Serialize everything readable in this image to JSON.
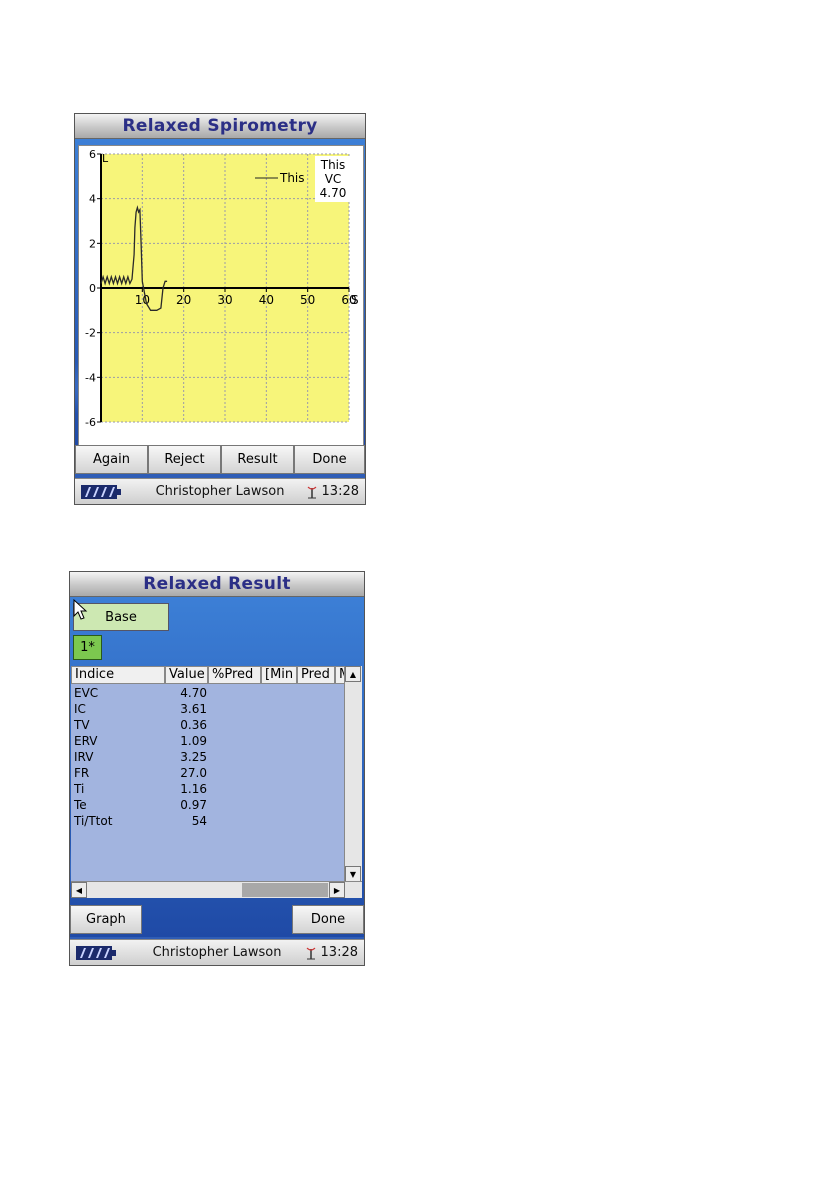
{
  "screen1": {
    "title": "Relaxed Spirometry",
    "legend_line_label": "This",
    "info_box": {
      "line1": "This",
      "line2": "VC",
      "line3": "4.70"
    },
    "buttons": [
      "Again",
      "Reject",
      "Result",
      "Done"
    ],
    "status": {
      "user": "Christopher Lawson",
      "time": "13:28"
    }
  },
  "chart_data": {
    "type": "line",
    "title": "Relaxed Spirometry",
    "ylabel": "L",
    "xlabel": "S",
    "xlim": [
      0,
      60
    ],
    "ylim": [
      -6,
      6
    ],
    "x_ticks": [
      "10",
      "20",
      "30",
      "40",
      "50",
      "60"
    ],
    "y_ticks": [
      "6",
      "4",
      "2",
      "0",
      "-2",
      "-4",
      "-6"
    ],
    "grid": true,
    "background": "#f7f57a",
    "line_color": "#2a2a2a",
    "series": [
      {
        "name": "This",
        "x": [
          0,
          0.5,
          1,
          1.5,
          2,
          2.5,
          3,
          3.5,
          4,
          4.5,
          5,
          5.5,
          6,
          6.5,
          7,
          7.5,
          8,
          8.2,
          8.5,
          8.8,
          9.1,
          9.4,
          9.7,
          10,
          10.5,
          11,
          12,
          13.5,
          14.5,
          15,
          15.5,
          16
        ],
        "y": [
          0.2,
          0.5,
          0.2,
          0.5,
          0.2,
          0.5,
          0.2,
          0.5,
          0.2,
          0.5,
          0.2,
          0.5,
          0.2,
          0.5,
          0.2,
          0.4,
          1.5,
          2.7,
          3.4,
          3.6,
          3.4,
          3.5,
          2.0,
          0.3,
          -0.2,
          -0.7,
          -1.0,
          -1.0,
          -0.9,
          0.0,
          0.3,
          0.3
        ]
      }
    ],
    "info_box": {
      "label": "This",
      "name": "VC",
      "value": 4.7
    }
  },
  "screen2": {
    "title": "Relaxed Result",
    "base_button": "Base",
    "tab_label": "1*",
    "columns": [
      "Indice",
      "Value",
      "%Pred",
      "[Min",
      "Pred",
      "M"
    ],
    "rows": [
      {
        "indice": "EVC",
        "value": "4.70"
      },
      {
        "indice": "IC",
        "value": "3.61"
      },
      {
        "indice": "TV",
        "value": "0.36"
      },
      {
        "indice": "ERV",
        "value": "1.09"
      },
      {
        "indice": "IRV",
        "value": "3.25"
      },
      {
        "indice": "FR",
        "value": "27.0"
      },
      {
        "indice": "Ti",
        "value": "1.16"
      },
      {
        "indice": "Te",
        "value": "0.97"
      },
      {
        "indice": "Ti/Ttot",
        "value": "54"
      }
    ],
    "buttons": {
      "left": "Graph",
      "right": "Done"
    },
    "status": {
      "user": "Christopher Lawson",
      "time": "13:28"
    }
  },
  "icons": {
    "battery": "battery-icon",
    "connection": "antenna-icon",
    "cursor": "mouse-pointer-icon",
    "scroll_up": "scroll-up-arrow-icon",
    "scroll_down": "scroll-down-arrow-icon",
    "scroll_left": "scroll-left-arrow-icon",
    "scroll_right": "scroll-right-arrow-icon"
  }
}
